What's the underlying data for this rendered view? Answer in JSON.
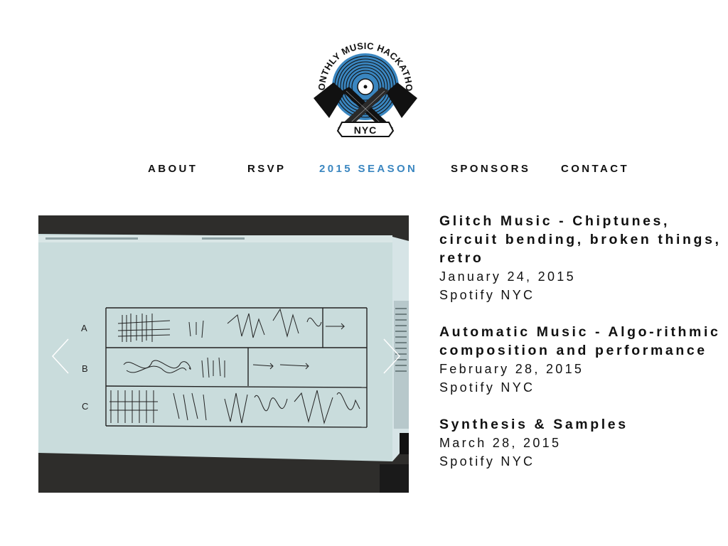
{
  "logo": {
    "arc_text": "MONTHLY MUSIC HACKATHON",
    "banner_text": "NYC",
    "colors": {
      "blue": "#3a86c0",
      "black": "#111111"
    }
  },
  "nav": {
    "items": [
      {
        "label": "ABOUT",
        "active": false
      },
      {
        "label": "RSVP",
        "active": false
      },
      {
        "label": "2015 SEASON",
        "active": true
      },
      {
        "label": "SPONSORS",
        "active": false
      },
      {
        "label": "CONTACT",
        "active": false
      }
    ],
    "active_color": "#3a86c0"
  },
  "slideshow": {
    "prev_icon": "chevron-left-icon",
    "next_icon": "chevron-right-icon",
    "sketch_row_labels": [
      "A",
      "B",
      "C"
    ]
  },
  "events": [
    {
      "title": "Glitch Music - Chiptunes, circuit bending, broken things, retro",
      "date": "January 24, 2015",
      "venue": "Spotify NYC"
    },
    {
      "title": "Automatic Music - Algo-rithmic composition and performance",
      "date": "February 28, 2015",
      "venue": "Spotify NYC"
    },
    {
      "title": "Synthesis & Samples",
      "date": "March 28, 2015",
      "venue": "Spotify NYC"
    }
  ]
}
